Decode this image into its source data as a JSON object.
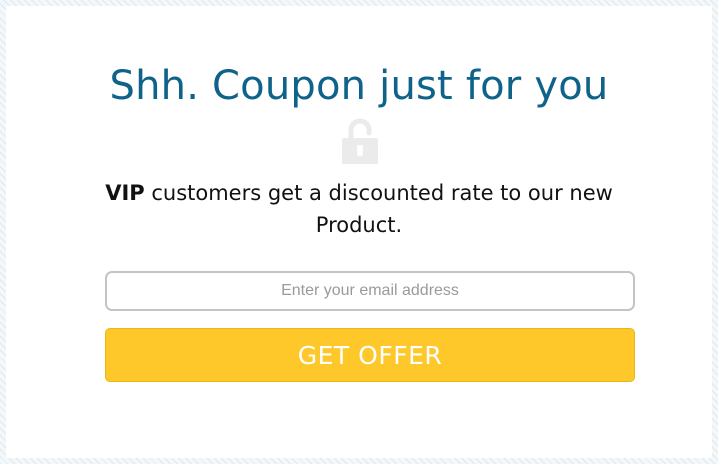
{
  "popup": {
    "headline": "Shh. Coupon just for you",
    "lock_icon": "lock-icon",
    "message_bold": "VIP",
    "message_rest": " customers get a discounted rate to our new Product.",
    "email_placeholder": "Enter your email address",
    "button_label": "GET OFFER"
  },
  "colors": {
    "headline": "#0f6289",
    "button": "#fec72a",
    "lock_icon": "#ebebeb"
  }
}
